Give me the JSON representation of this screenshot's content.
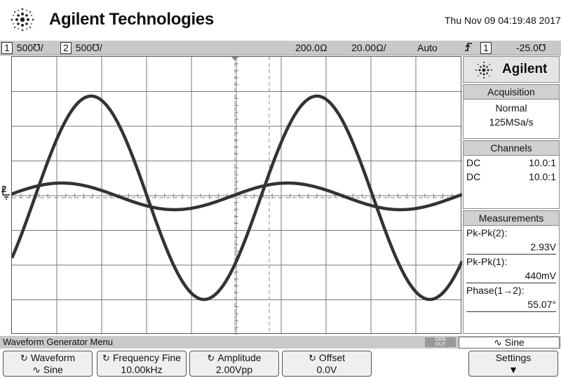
{
  "header": {
    "brand": "Agilent Technologies",
    "datetime": "Thu Nov 09 04:19:48 2017"
  },
  "status_bar": {
    "ch1_num": "1",
    "ch1_scale": "500℧/",
    "ch2_num": "2",
    "ch2_scale": "500℧/",
    "timebase_pos": "200.0Ω",
    "timebase_scale": "20.00Ω/",
    "trigger_mode": "Auto",
    "trigger_icon": "rising-edge-icon",
    "trigger_source": "1",
    "trigger_level": "-25.0℧"
  },
  "scope": {
    "ch_marker": "2",
    "trace_color": "#333333",
    "ch1_waveform": {
      "peak_to_peak": "440mV",
      "cycles_on_screen": 2
    },
    "ch2_waveform": {
      "peak_to_peak": "2.93V",
      "cycles_on_screen": 2
    }
  },
  "panel": {
    "logo": "Agilent",
    "acquisition": {
      "title": "Acquisition",
      "mode": "Normal",
      "rate": "125MSa/s"
    },
    "channels": {
      "title": "Channels",
      "rows": [
        {
          "coupling": "DC",
          "probe": "10.0:1"
        },
        {
          "coupling": "DC",
          "probe": "10.0:1"
        }
      ]
    },
    "measurements": {
      "title": "Measurements",
      "items": [
        {
          "label": "Pk-Pk(2):",
          "value": "2.93V"
        },
        {
          "label": "Pk-Pk(1):",
          "value": "440mV"
        },
        {
          "label": "Phase(1→2):",
          "value": "55.07°"
        }
      ]
    }
  },
  "footer": {
    "menu_title": "Waveform Generator Menu",
    "gen_badge_top": "GEN",
    "gen_badge_bottom": "OUT",
    "gen_shape": "∿ Sine",
    "softkeys": [
      {
        "label": "Waveform",
        "value": "∿  Sine"
      },
      {
        "label": "Frequency Fine",
        "value": "10.00kHz"
      },
      {
        "label": "Amplitude",
        "value": "2.00Vpp"
      },
      {
        "label": "Offset",
        "value": "0.0V"
      },
      {
        "label": "Settings",
        "value": "▼"
      }
    ]
  }
}
